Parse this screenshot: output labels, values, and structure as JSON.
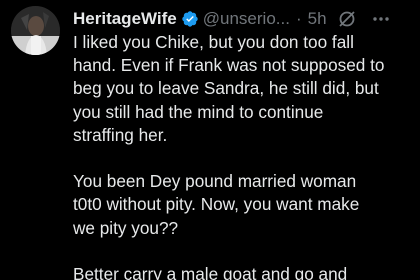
{
  "author": {
    "display_name": "HeritageWife",
    "handle": "@unserio...",
    "separator": "·",
    "time": "5h",
    "avatar_icon": "profile-photo",
    "verified_icon": "verified-badge-icon",
    "verified_color": "#1d9bf0"
  },
  "actions": {
    "grok_icon": "grok-icon",
    "more_icon": "more-options-icon"
  },
  "tweet": {
    "lines": [
      "I liked you Chike, but you don too fall",
      "hand. Even if Frank was not supposed to",
      "beg you to leave Sandra, he still did, but",
      "you still had the mind to continue",
      "straffing her.",
      "",
      "You been Dey pound married woman",
      "t0t0 without pity. Now, you want make",
      "we pity you??",
      "",
      "Better carry a male goat and go and"
    ]
  },
  "colors": {
    "background": "#000000",
    "primary_text": "#e7e9ea",
    "secondary_text": "#71767b"
  }
}
